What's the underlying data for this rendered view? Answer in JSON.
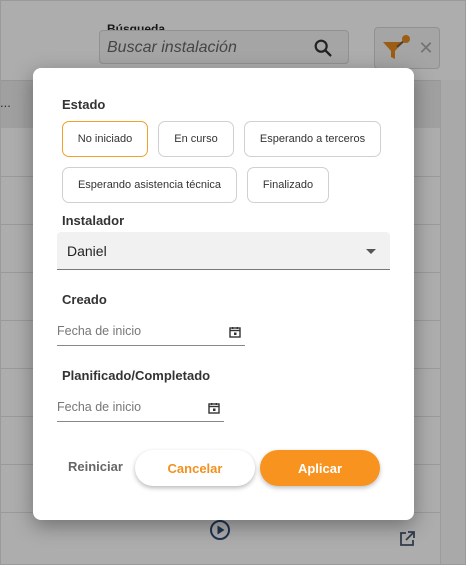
{
  "search": {
    "label": "Búsqueda",
    "placeholder": "Buscar instalación"
  },
  "toolbar": {
    "close_glyph": "✕"
  },
  "table": {
    "header_ellipsis": "..."
  },
  "icons": {
    "search": "search-icon",
    "filter": "filter-icon",
    "close": "close-icon",
    "play": "play-icon",
    "external": "open-external-icon",
    "calendar": "calendar-icon",
    "dropdown": "caret-down-icon"
  },
  "colors": {
    "accent": "#f7931e",
    "selected_border": "#f2a12c",
    "icon_blue": "#2f4d7a"
  },
  "filter_dialog": {
    "estado": {
      "label": "Estado",
      "options": [
        "No iniciado",
        "En curso",
        "Esperando a terceros",
        "Esperando asistencia técnica",
        "Finalizado"
      ],
      "selected": "No iniciado"
    },
    "instalador": {
      "label": "Instalador",
      "value": "Daniel"
    },
    "creado": {
      "label": "Creado",
      "placeholder": "Fecha de inicio"
    },
    "planificado": {
      "label": "Planificado/Completado",
      "placeholder": "Fecha de inicio"
    },
    "buttons": {
      "reset": "Reiniciar",
      "cancel": "Cancelar",
      "apply": "Aplicar"
    }
  }
}
